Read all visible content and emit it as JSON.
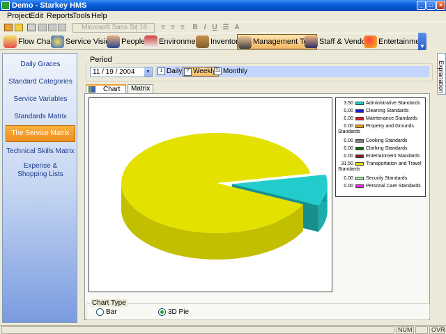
{
  "window": {
    "title": "Demo - Starkey HMS"
  },
  "menu": [
    {
      "label": "Project"
    },
    {
      "label": "Edit"
    },
    {
      "label": "Reports"
    },
    {
      "label": "Tools"
    },
    {
      "label": "Help"
    }
  ],
  "format_toolbar": {
    "font": "Microsoft Sans Se",
    "size": "18"
  },
  "nav": [
    {
      "label": "Flow Chart",
      "icon": "flowchart-icon"
    },
    {
      "label": "Service Vision",
      "icon": "service-vision-icon"
    },
    {
      "label": "People",
      "icon": "people-icon"
    },
    {
      "label": "Environment",
      "icon": "house-icon"
    },
    {
      "label": "Inventory",
      "icon": "inventory-icon"
    },
    {
      "label": "Management Tool",
      "icon": "management-icon",
      "active": true
    },
    {
      "label": "Staff & Vendors",
      "icon": "staff-icon"
    },
    {
      "label": "Entertainment",
      "icon": "balloons-icon"
    }
  ],
  "sidebar": [
    {
      "label": "Daily Graces"
    },
    {
      "label": "Standard Categories"
    },
    {
      "label": "Service Variables"
    },
    {
      "label": "Standards Matrix"
    },
    {
      "label": "The Service Matrix",
      "active": true
    },
    {
      "label": "Technical Skills Matrix"
    },
    {
      "label": "Expense & Shopping Lists"
    }
  ],
  "period": {
    "label": "Period",
    "date": "11 / 19 / 2004",
    "options": [
      {
        "label": "Daily"
      },
      {
        "label": "Weekly",
        "active": true
      },
      {
        "label": "Monthly"
      }
    ]
  },
  "tabs": [
    {
      "label": "Chart",
      "active": true
    },
    {
      "label": "Matrix"
    }
  ],
  "chart_data": {
    "type": "pie",
    "title": "",
    "series": [
      {
        "name": "Administrative Standards",
        "value": 3.5,
        "value_label": "3.50",
        "color": "#22cccc"
      },
      {
        "name": "Cleaning Standards",
        "value": 0,
        "value_label": "0.00",
        "color": "#1a1acc"
      },
      {
        "name": "Maintenance Standards",
        "value": 0,
        "value_label": "0.00",
        "color": "#cc2222"
      },
      {
        "name": "Property and Grounds Standards",
        "value": 0,
        "value_label": "0.00",
        "color": "#e0a020"
      },
      {
        "name": "Cooking Standards",
        "value": 0,
        "value_label": "0.00",
        "color": "#808080"
      },
      {
        "name": "Clothing Standards",
        "value": 0,
        "value_label": "0.00",
        "color": "#1a6a1a"
      },
      {
        "name": "Entertainment Standards",
        "value": 0,
        "value_label": "0.00",
        "color": "#8a1a1a"
      },
      {
        "name": "Transportation and Travel Standards",
        "value": 31.5,
        "value_label": "31.50",
        "color": "#e4e000"
      },
      {
        "name": "Security Standards",
        "value": 0,
        "value_label": "0.00",
        "color": "#a8e0a8"
      },
      {
        "name": "Personal Care Standards",
        "value": 0,
        "value_label": "0.00",
        "color": "#e030e0"
      }
    ]
  },
  "chart_type": {
    "label": "Chart Type",
    "options": [
      {
        "label": "Bar"
      },
      {
        "label": "3D Pie",
        "selected": true
      }
    ]
  },
  "explanation_tab": "Explanation",
  "status": {
    "num": "NUM",
    "ovr": "OVR"
  }
}
